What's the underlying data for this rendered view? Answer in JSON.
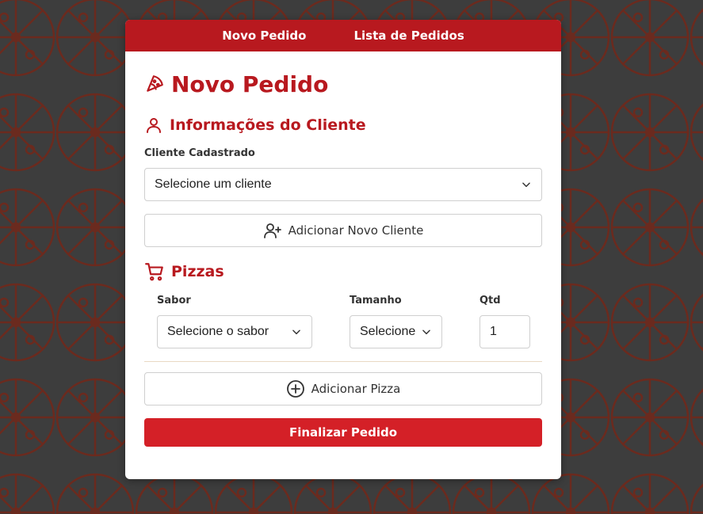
{
  "colors": {
    "brand": "#b8191f",
    "primary_button": "#d42027",
    "background": "#3d3d3d",
    "pattern": "#6b2a1e"
  },
  "nav": {
    "items": [
      {
        "label": "Novo Pedido",
        "icon": null
      },
      {
        "label": "Lista de Pedidos",
        "icon": null
      }
    ]
  },
  "page": {
    "title": "Novo Pedido",
    "title_icon": "pizza-slice-icon"
  },
  "client_section": {
    "title": "Informações do Cliente",
    "icon": "user-icon",
    "client_label": "Cliente Cadastrado",
    "client_select_value": "Selecione um cliente",
    "add_client_label": "Adicionar Novo Cliente",
    "add_client_icon": "user-plus-icon"
  },
  "pizzas_section": {
    "title": "Pizzas",
    "icon": "cart-icon",
    "flavor_label": "Sabor",
    "flavor_value": "Selecione o sabor",
    "size_label": "Tamanho",
    "size_value": "Selecione",
    "qty_label": "Qtd",
    "qty_value": "1",
    "add_pizza_label": "Adicionar Pizza",
    "add_pizza_icon": "plus-circle-icon"
  },
  "finalize_label": "Finalizar Pedido"
}
